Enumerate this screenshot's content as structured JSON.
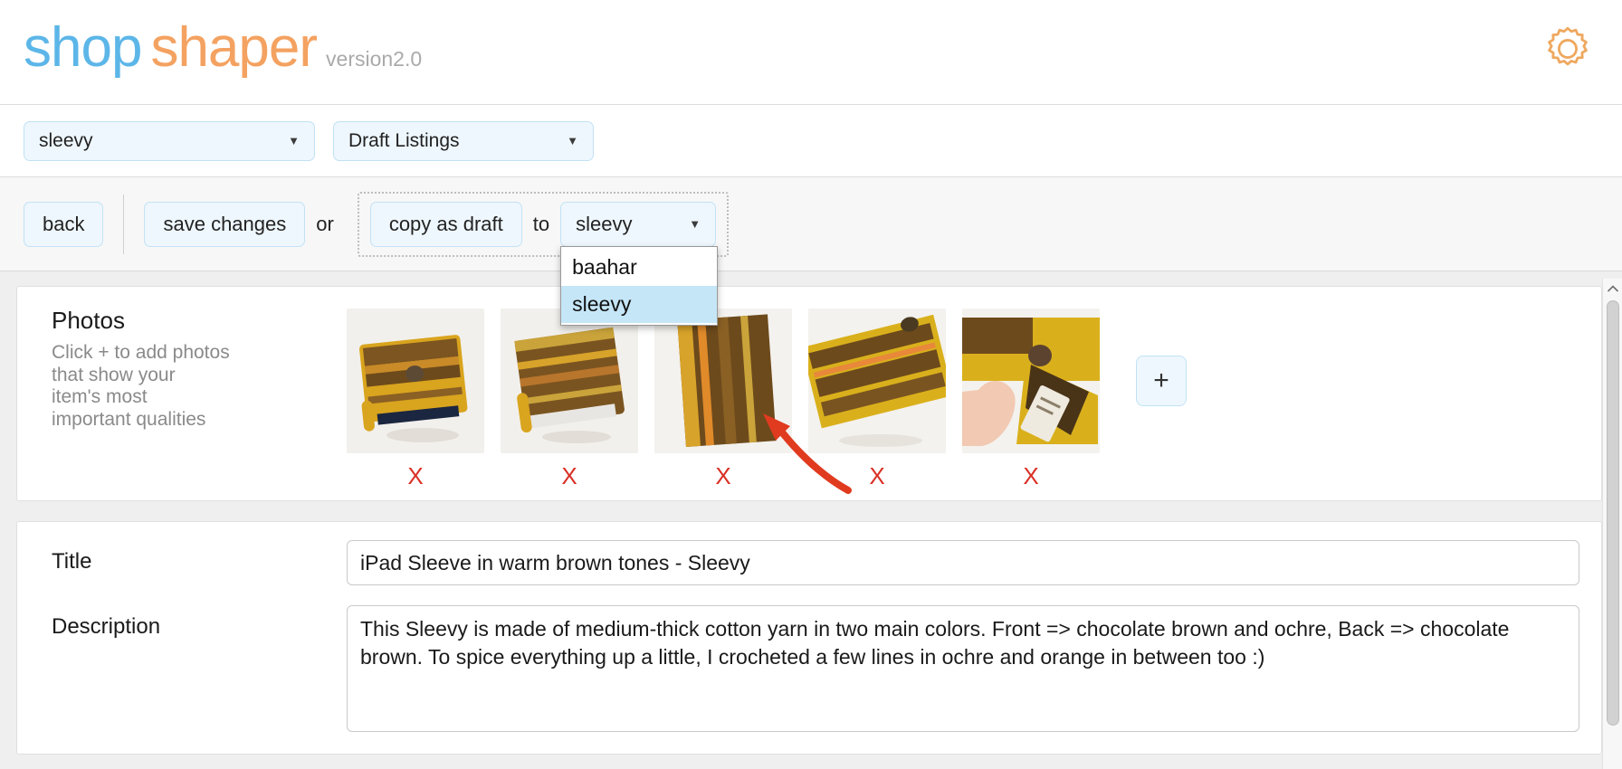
{
  "header": {
    "logo_part1": "shop",
    "logo_part2": "shaper",
    "version": "version2.0",
    "settings_icon": "gear-icon",
    "brand_blue": "#5cb6e8",
    "brand_orange": "#f4a261"
  },
  "selectbar": {
    "shop_select": {
      "value": "sleevy",
      "caret": "▼"
    },
    "listing_select": {
      "value": "Draft Listings",
      "caret": "▼"
    }
  },
  "toolbar": {
    "back_label": "back",
    "save_label": "save changes",
    "or_label": "or",
    "copy_label": "copy as draft",
    "to_label": "to",
    "target_shop": {
      "value": "sleevy",
      "caret": "▼"
    },
    "dropdown_open": true,
    "dropdown_options": [
      {
        "label": "baahar",
        "selected": false
      },
      {
        "label": "sleevy",
        "selected": true
      }
    ],
    "annotation": {
      "type": "arrow",
      "color": "#e03b1f"
    }
  },
  "photos": {
    "title": "Photos",
    "help_line1": "Click + to add photos",
    "help_line2": "that show your",
    "help_line3": "item's most",
    "help_line4": "important qualities",
    "delete_label": "X",
    "add_label": "+",
    "items": [
      {
        "alt": "crocheted ipad sleeve front angled view",
        "delete": "X"
      },
      {
        "alt": "crocheted ipad sleeve striped top view",
        "delete": "X"
      },
      {
        "alt": "crocheted ipad sleeve brown ochre stripes",
        "delete": "X"
      },
      {
        "alt": "crocheted ipad sleeve flat stripes close up",
        "delete": "X"
      },
      {
        "alt": "hand opening sleeve showing label",
        "delete": "X"
      }
    ]
  },
  "fields": {
    "title_label": "Title",
    "title_value": "iPad Sleeve in warm brown tones - Sleevy",
    "title_placeholder": "",
    "description_label": "Description",
    "description_value": "This Sleevy is made of medium-thick cotton yarn in two main colors. Front => chocolate brown and ochre, Back => chocolate brown. To spice everything up a little, I crocheted a few lines in ochre and orange in between too :)",
    "description_placeholder": ""
  }
}
